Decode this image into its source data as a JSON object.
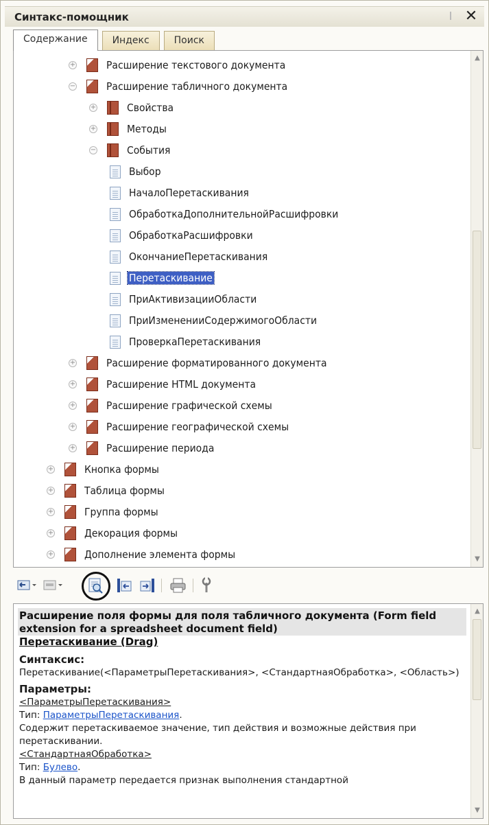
{
  "window": {
    "title": "Синтакс-помощник",
    "close_glyph": "✕"
  },
  "tabs": [
    {
      "label": "Содержание",
      "active": true
    },
    {
      "label": "Индекс",
      "active": false
    },
    {
      "label": "Поиск",
      "active": false
    }
  ],
  "tree": {
    "items": [
      {
        "label": "Расширение текстового документа",
        "icon": "book-multi-icon",
        "expander": "+",
        "selected": false
      },
      {
        "label": "Расширение табличного документа",
        "icon": "book-multi-icon",
        "expander": "−",
        "selected": false
      },
      {
        "label": "Свойства",
        "icon": "book-icon",
        "expander": "+",
        "selected": false
      },
      {
        "label": "Методы",
        "icon": "book-icon",
        "expander": "+",
        "selected": false
      },
      {
        "label": "События",
        "icon": "book-icon",
        "expander": "−",
        "selected": false
      },
      {
        "label": "Выбор",
        "icon": "page-icon",
        "expander": "",
        "selected": false
      },
      {
        "label": "НачалоПеретаскивания",
        "icon": "page-icon",
        "expander": "",
        "selected": false
      },
      {
        "label": "ОбработкаДополнительнойРасшифровки",
        "icon": "page-icon",
        "expander": "",
        "selected": false
      },
      {
        "label": "ОбработкаРасшифровки",
        "icon": "page-icon",
        "expander": "",
        "selected": false
      },
      {
        "label": "ОкончаниеПеретаскивания",
        "icon": "page-icon",
        "expander": "",
        "selected": false
      },
      {
        "label": "Перетаскивание",
        "icon": "page-icon",
        "expander": "",
        "selected": true
      },
      {
        "label": "ПриАктивизацииОбласти",
        "icon": "page-icon",
        "expander": "",
        "selected": false
      },
      {
        "label": "ПриИзмененииСодержимогоОбласти",
        "icon": "page-icon",
        "expander": "",
        "selected": false
      },
      {
        "label": "ПроверкаПеретаскивания",
        "icon": "page-icon",
        "expander": "",
        "selected": false
      },
      {
        "label": "Расширение форматированного документа",
        "icon": "book-multi-icon",
        "expander": "+",
        "selected": false
      },
      {
        "label": "Расширение HTML документа",
        "icon": "book-multi-icon",
        "expander": "+",
        "selected": false
      },
      {
        "label": "Расширение графической схемы",
        "icon": "book-multi-icon",
        "expander": "+",
        "selected": false
      },
      {
        "label": "Расширение географической схемы",
        "icon": "book-multi-icon",
        "expander": "+",
        "selected": false
      },
      {
        "label": "Расширение периода",
        "icon": "book-multi-icon",
        "expander": "+",
        "selected": false
      },
      {
        "label": "Кнопка формы",
        "icon": "book-multi-icon",
        "expander": "+",
        "selected": false
      },
      {
        "label": "Таблица формы",
        "icon": "book-multi-icon",
        "expander": "+",
        "selected": false
      },
      {
        "label": "Группа формы",
        "icon": "book-multi-icon",
        "expander": "+",
        "selected": false
      },
      {
        "label": "Декорация формы",
        "icon": "book-multi-icon",
        "expander": "+",
        "selected": false
      },
      {
        "label": "Дополнение элемента формы",
        "icon": "book-multi-icon",
        "expander": "+",
        "selected": false
      }
    ]
  },
  "toolbar": {
    "buttons": [
      "back-icon",
      "forward-icon",
      "sync-contents-icon",
      "previous-topic-icon",
      "next-topic-icon",
      "print-icon",
      "settings-icon"
    ]
  },
  "description": {
    "heading": "Расширение поля формы для поля табличного документа (Form field extension for a spreadsheet document field)",
    "topic": "Перетаскивание (Drag)",
    "syntax_title": "Синтаксис:",
    "syntax_text": "Перетаскивание(<ПараметрыПеретаскивания>, <СтандартнаяОбработка>, <Область>)",
    "params_title": "Параметры:",
    "param1_name": "<ПараметрыПеретаскивания>",
    "param1_type_label": "Тип: ",
    "param1_type": "ПараметрыПеретаскивания",
    "param1_type_end": ".",
    "param1_desc": "Содержит перетаскиваемое значение, тип действия и возможные действия при перетаскивании.",
    "param2_name": "<СтандартнаяОбработка>",
    "param2_type_label": "Тип: ",
    "param2_type": "Булево",
    "param2_type_end": ".",
    "param2_desc": "В данный параметр передается признак выполнения стандартной"
  }
}
